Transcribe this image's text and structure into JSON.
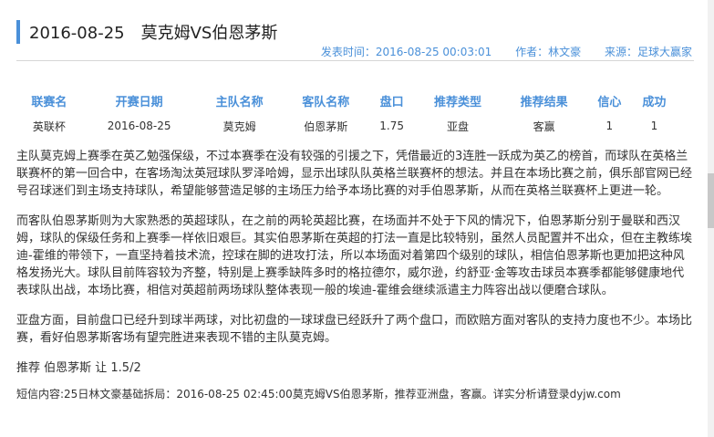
{
  "header": {
    "date": "2016-08-25",
    "match_title": "莫克姆VS伯恩茅斯",
    "publish_time": "发表时间：2016-08-25 00:03:01",
    "author": "作者：林文豪",
    "source": "来源：足球大赢家"
  },
  "table": {
    "headers": [
      "联赛名",
      "开赛日期",
      "主队名称",
      "客队名称",
      "盘口",
      "推荐类型",
      "推荐结果",
      "信心",
      "成功"
    ],
    "row": [
      "英联杯",
      "2016-08-25",
      "莫克姆",
      "伯恩茅斯",
      "1.75",
      "亚盘",
      "客赢",
      "1",
      "1"
    ]
  },
  "article": {
    "p1": "主队莫克姆上赛季在英乙勉强保级，不过本赛季在没有较强的引援之下，凭借最近的3连胜一跃成为英乙的榜首，而球队在英格兰联赛杯的第一回合中，在客场淘汰英冠球队罗泽哈姆，显示出球队队英格兰联赛杯的想法。并且在本场比赛之前，俱乐部官网已经号召球迷们到主场支持球队，希望能够营造足够的主场压力给予本场比赛的对手伯恩茅斯，从而在英格兰联赛杯上更进一轮。",
    "p2": "而客队伯恩茅斯则为大家熟悉的英超球队，在之前的两轮英超比赛，在场面并不处于下风的情况下，伯恩茅斯分别于曼联和西汉姆，球队的保级任务和上赛季一样依旧艰巨。其实伯恩茅斯在英超的打法一直是比较特别，虽然人员配置并不出众，但在主教练埃迪-霍维的带领下，一直坚持着技术流，控球在脚的进攻打法，所以本场面对着第四个级别的球队，相信伯恩茅斯也更加把这种风格发扬光大。球队目前阵容较为齐整，特别是上赛季缺阵多时的格拉德尔，威尔逊，约舒亚·金等攻击球员本赛季都能够健康地代表球队出战，本场比赛，相信对英超前两场球队整体表现一般的埃迪-霍维会继续派遣主力阵容出战以便磨合球队。",
    "p3": "亚盘方面，目前盘口已经升到球半两球，对比初盘的一球球盘已经跃升了两个盘口，而欧赔方面对客队的支持力度也不少。本场比赛，看好伯恩茅斯客场有望完胜进来表现不错的主队莫克姆。",
    "recommend": "推荐 伯恩茅斯 让 1.5/2",
    "sms": "短信内容:25日林文豪基础拆局：2016-08-25 02:45:00莫克姆VS伯恩茅斯，推荐亚洲盘，客赢。详实分析请登录dyjw.com"
  }
}
